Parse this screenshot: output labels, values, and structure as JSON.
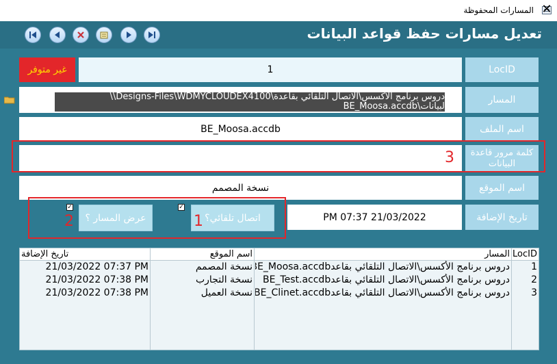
{
  "window": {
    "title": "المسارات المحفوظة",
    "close_glyph": "✕"
  },
  "header": {
    "title": "تعديل مسارات حفظ قواعد البيانات"
  },
  "nav_icons": [
    "first-record-icon",
    "previous-record-icon",
    "delete-record-icon",
    "new-record-icon",
    "next-record-icon",
    "last-record-icon"
  ],
  "form": {
    "locid_label": "LocID",
    "locid_value": "1",
    "status_badge": "غير متوفر",
    "path_label": "المسار",
    "path_value": "دروس برنامج الأكسس\\الاتصال التلقائي بقاعدة\\Designs-Files\\WDMYCLOUDEX4100\\\\ لبيانات\\BE_Moosa.accdb",
    "filename_label": "اسم الملف",
    "filename_value": "BE_Moosa.accdb",
    "password_label": "كلمة مرور قاعدة البيانات",
    "password_value": "",
    "location_label": "اسم الموقع",
    "location_value": "نسخة المصمم",
    "added_label": "تاريخ الإضافة",
    "added_value": "21/03/2022 07:37 PM",
    "auto_connect_button": "اتصال تلقائي؟",
    "show_path_button": "عرض المسار ؟",
    "auto_connect_checked": true,
    "show_path_checked": true
  },
  "annotations": {
    "n1": "1",
    "n2": "2",
    "n3": "3"
  },
  "table": {
    "headers": {
      "locid": "LocID",
      "path": "المسار",
      "site": "اسم الموقع",
      "date": "تاريخ الإضافة"
    },
    "rows": [
      {
        "locid": "1",
        "path": "دروس برنامج الأكسس\\الاتصال التلقائي بقاعدBE_Moosa.accdb",
        "site": "نسخة المصمم",
        "date": "21/03/2022 07:37 PM"
      },
      {
        "locid": "2",
        "path": "دروس برنامج الأكسس\\الاتصال التلقائي بقاعدBE_Test.accdb",
        "site": "نسخة التجارب",
        "date": "21/03/2022 07:38 PM"
      },
      {
        "locid": "3",
        "path": "دروس برنامج الأكسس\\الاتصال التلقائي بقاعدBE_Clinet.accdb",
        "site": "نسخة العميل",
        "date": "21/03/2022 07:38 PM"
      }
    ]
  },
  "colors": {
    "background": "#2e7a91",
    "label_bg": "#a9d7ea",
    "status_red": "#e3262a",
    "status_text": "#ffd800",
    "annotation": "#e3262a"
  }
}
